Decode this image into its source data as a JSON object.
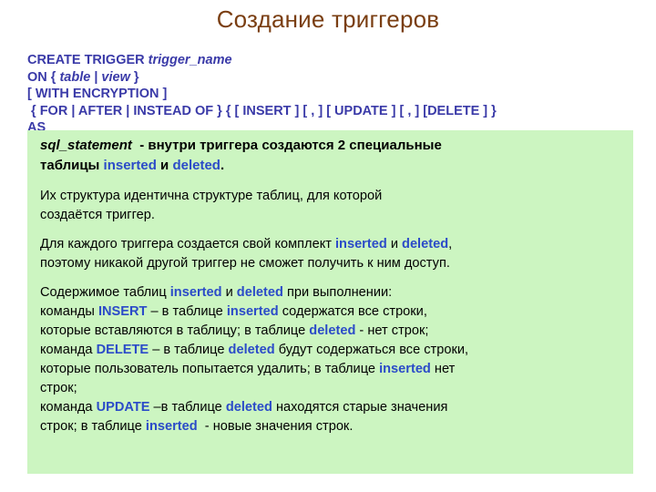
{
  "slide": {
    "title": "Создание триггеров",
    "title_color": "#7A3E12",
    "panel_color": "#CCF5C1",
    "syntax_color": "#3A3AA8",
    "keyword_color": "#2B4BC8"
  },
  "syntax": {
    "line1_kw": "CREATE TRIGGER ",
    "line1_name": "trigger_name",
    "line2_kw": "ON ",
    "line2_open": "{ ",
    "line2_a": "table",
    "line2_pipe": " | ",
    "line2_b": "view",
    "line2_close": " }",
    "line3": "[ WITH ENCRYPTION ]",
    "line4": " { FOR | AFTER | INSTEAD OF } { [ INSERT ] [ , ] [ UPDATE ] [ , ] [DELETE ] }",
    "line5": "AS"
  },
  "panel": {
    "lead": {
      "name": "sql_statement",
      "text_a": "  - внутри триггера создаются 2 специальные",
      "text_b": "таблицы ",
      "kw1": "inserted",
      "text_c": " и ",
      "kw2": "deleted",
      "text_d": "."
    },
    "p1": "Их структура идентична структуре таблиц, для которой\nсоздаётся триггер.",
    "p2": {
      "a": "Для каждого триггера создается свой комплект ",
      "kw1": "inserted",
      "b": " и ",
      "kw2": "deleted",
      "c": ",\nпоэтому никакой другой триггер не сможет получить к ним доступ."
    },
    "p3": {
      "l1a": "Содержимое таблиц ",
      "l1kw1": "inserted",
      "l1b": " и ",
      "l1kw2": "deleted",
      "l1c": " при выполнении:",
      "l2a": "команды ",
      "l2kw1": "INSERT",
      "l2b": " – в таблице ",
      "l2kw2": "inserted",
      "l2c": " содержатся все строки,",
      "l3a": "которые вставляются в таблицу; в таблице ",
      "l3kw1": "deleted",
      "l3b": " - нет строк;",
      "l4a": "команда ",
      "l4kw1": "DELETE",
      "l4b": " – в таблице ",
      "l4kw2": "deleted",
      "l4c": " будут содержаться все строки,",
      "l5a": "которые пользователь попытается удалить; в таблице ",
      "l5kw1": "inserted",
      "l5b": " нет",
      "l6": "строк;",
      "l7a": "команда ",
      "l7kw1": "UPDATE",
      "l7b": " –в таблице ",
      "l7kw2": "deleted",
      "l7c": " находятся старые значения",
      "l8a": "строк; в таблице ",
      "l8kw1": "inserted",
      "l8b": "  - новые значения строк."
    }
  }
}
